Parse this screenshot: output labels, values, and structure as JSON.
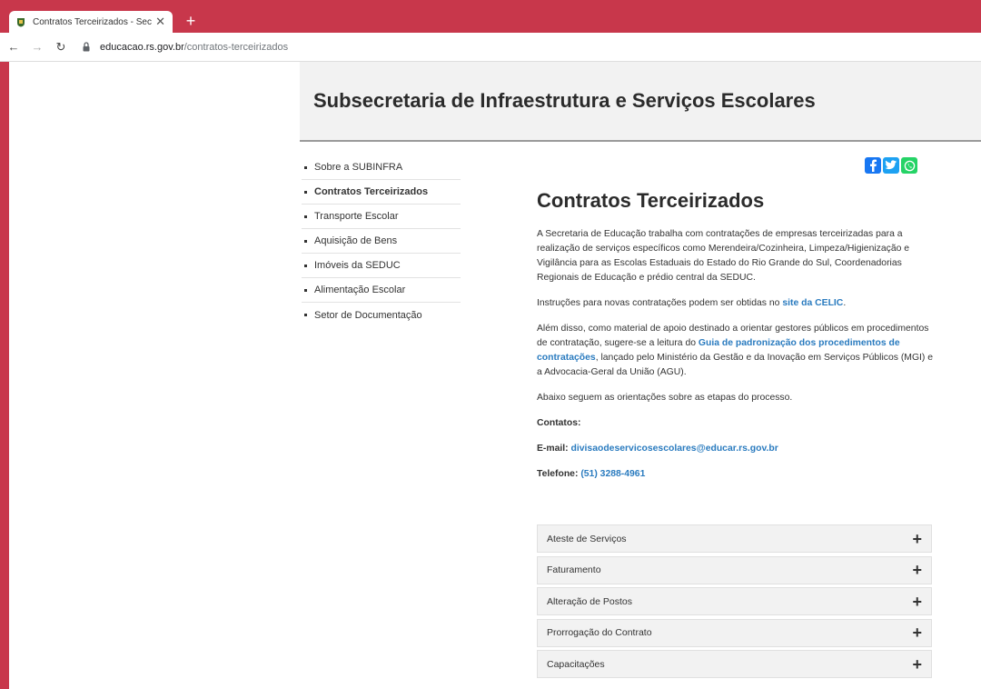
{
  "browser": {
    "tab_title": "Contratos Terceirizados - Secreta",
    "url_host": "educacao.rs.gov.br",
    "url_path": "/contratos-terceirizados"
  },
  "header": {
    "title": "Subsecretaria de Infraestrutura e Serviços Escolares"
  },
  "sidebar": {
    "items": [
      {
        "label": "Sobre a SUBINFRA",
        "active": false
      },
      {
        "label": "Contratos Terceirizados",
        "active": true
      },
      {
        "label": "Transporte Escolar",
        "active": false
      },
      {
        "label": "Aquisição de Bens",
        "active": false
      },
      {
        "label": "Imóveis da SEDUC",
        "active": false
      },
      {
        "label": "Alimentação Escolar",
        "active": false
      },
      {
        "label": "Setor de Documentação",
        "active": false
      }
    ]
  },
  "share": {
    "facebook": "f",
    "twitter": "t",
    "whatsapp": "w"
  },
  "main": {
    "title": "Contratos Terceirizados",
    "p1": "A Secretaria de Educação trabalha com contratações de empresas terceirizadas para a realização de serviços específicos como Merendeira/Cozinheira, Limpeza/Higienização e Vigilância para as Escolas Estaduais do Estado do Rio Grande do Sul, Coordenadorias Regionais de Educação e prédio central da SEDUC.",
    "p2_pre": "Instruções para novas contratações podem ser obtidas no ",
    "p2_link": "site da CELIC",
    "p2_post": ".",
    "p3_pre": "Além disso, como material de apoio destinado a orientar gestores públicos em procedimentos de contratação,  sugere-se a leitura do ",
    "p3_link": "Guia de padronização dos procedimentos de contratações",
    "p3_post": ", lançado pelo Ministério da Gestão e da Inovação em Serviços Públicos (MGI) e a Advocacia-Geral da União (AGU).",
    "p4": "Abaixo seguem as orientações sobre as etapas do processo.",
    "contacts_label": "Contatos:",
    "email_label": "E-mail: ",
    "email_value": "divisaodeservicosescolares@educar.rs.gov.br",
    "phone_label": "Telefone: ",
    "phone_value": "(51) 3288-4961"
  },
  "accordion": {
    "items": [
      {
        "label": "Ateste de Serviços",
        "icon": "+"
      },
      {
        "label": "Faturamento",
        "icon": "+"
      },
      {
        "label": "Alteração de Postos",
        "icon": "+"
      },
      {
        "label": "Prorrogação do Contrato",
        "icon": "+"
      },
      {
        "label": "Capacitações",
        "icon": "+"
      }
    ]
  },
  "colors": {
    "frame": "#c8374b",
    "link": "#2a7bbf",
    "facebook": "#1877f2",
    "twitter": "#1da1f2",
    "whatsapp": "#25d366"
  }
}
